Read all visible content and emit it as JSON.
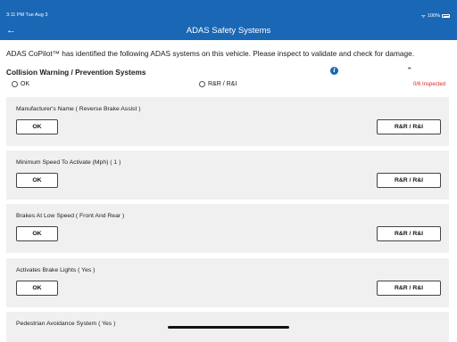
{
  "status_bar": {
    "time": "3:11 PM  Tue Aug 3",
    "wifi": "ᯤ",
    "battery_text": "100%"
  },
  "nav": {
    "back_icon": "←",
    "title": "ADAS Safety Systems"
  },
  "intro_text": "ADAS CoPilot™ has identified the following ADAS systems on this vehicle. Please inspect to validate and check for damage.",
  "section": {
    "title": "Collision Warning / Prevention Systems",
    "info_icon": "i",
    "collapse_icon": "⌃",
    "inspected_status": "0/6 Inspected",
    "options": [
      "OK",
      "R&R / R&I"
    ]
  },
  "items": [
    {
      "label": "Manufacturer's Name ( Reverse Brake Assist )",
      "ok_label": "OK",
      "rr_label": "R&R / R&I"
    },
    {
      "label": "Minimum Speed To Activate (Mph) ( 1 )",
      "ok_label": "OK",
      "rr_label": "R&R / R&I"
    },
    {
      "label": "Brakes At Low Speed ( Front And Rear )",
      "ok_label": "OK",
      "rr_label": "R&R / R&I"
    },
    {
      "label": "Activates Brake Lights ( Yes )",
      "ok_label": "OK",
      "rr_label": "R&R / R&I"
    },
    {
      "label": "Pedestrian Avoidance System ( Yes )"
    }
  ],
  "colors": {
    "header": "#1a67b5",
    "card": "#f0f0f0",
    "status_red": "#e02020"
  }
}
